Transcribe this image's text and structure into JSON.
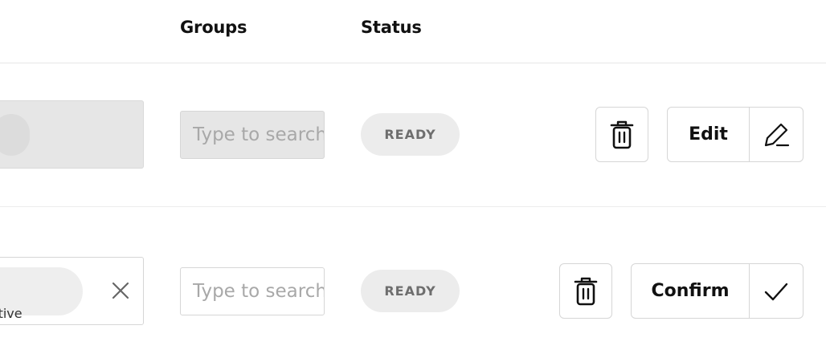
{
  "header": {
    "groups": "Groups",
    "status": "Status"
  },
  "rows": [
    {
      "state": "disabled",
      "group_placeholder": "Type to search",
      "status": "READY",
      "action_label": "Edit",
      "action_icon": "pencil-icon",
      "delete_icon": "trash-icon"
    },
    {
      "state": "enabled",
      "chip_text": "f Executive",
      "group_placeholder": "Type to search",
      "status": "READY",
      "action_label": "Confirm",
      "action_icon": "checkmark-icon",
      "delete_icon": "trash-icon"
    }
  ],
  "colors": {
    "border": "#d6d6d6",
    "disabled_fill": "#e6e6e6",
    "badge_fill": "#ececec",
    "badge_text": "#6e6e6e"
  }
}
